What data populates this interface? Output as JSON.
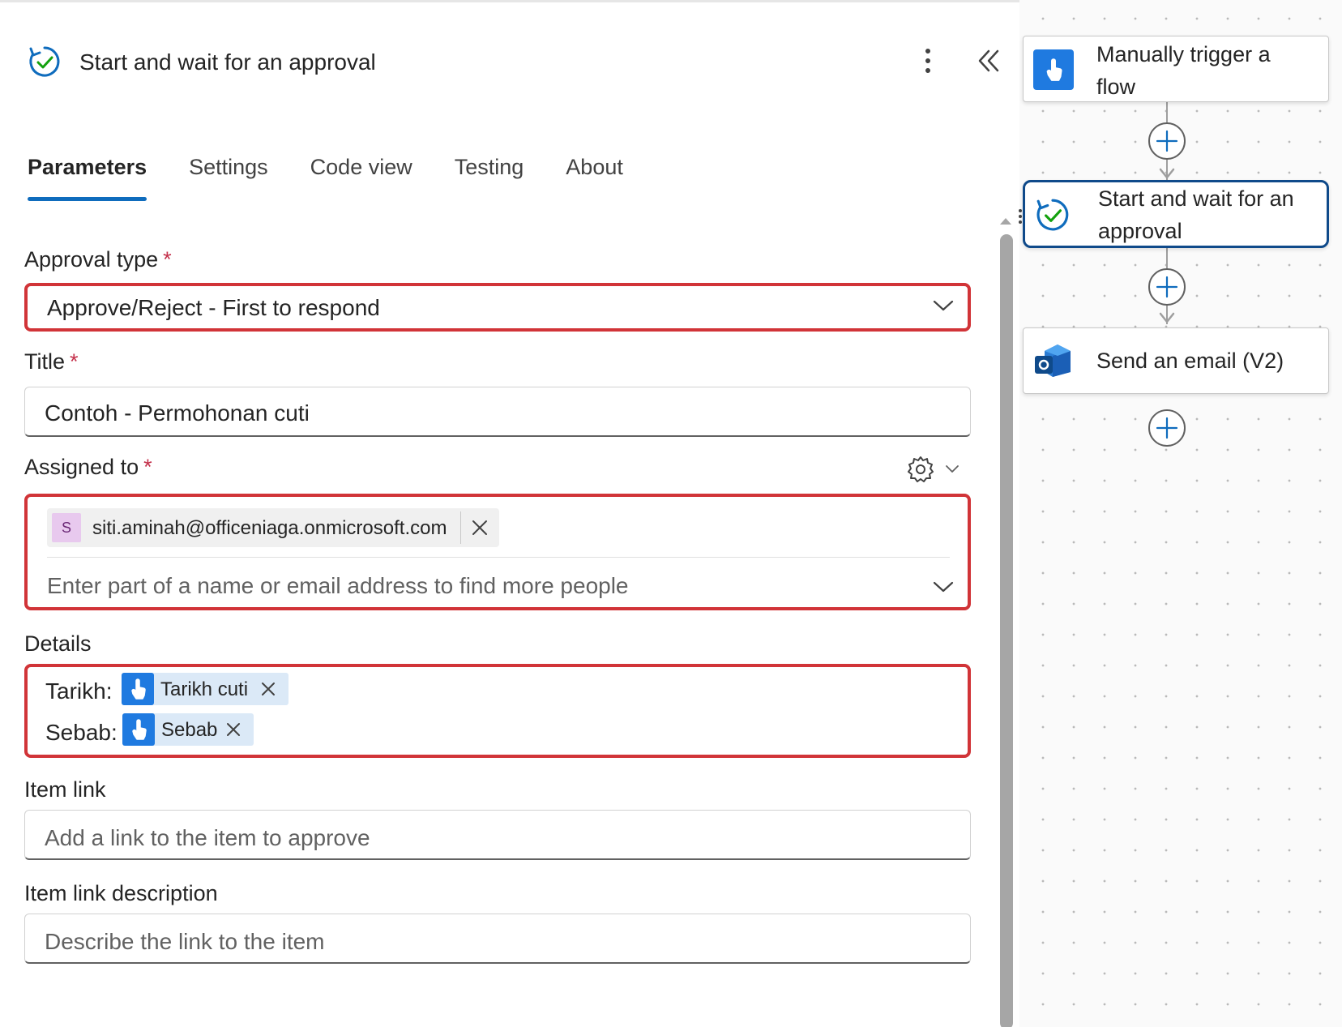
{
  "panel": {
    "title": "Start and wait for an approval",
    "tabs": [
      {
        "label": "Parameters",
        "active": true
      },
      {
        "label": "Settings",
        "active": false
      },
      {
        "label": "Code view",
        "active": false
      },
      {
        "label": "Testing",
        "active": false
      },
      {
        "label": "About",
        "active": false
      }
    ]
  },
  "form": {
    "approval_type": {
      "label": "Approval type",
      "required_mark": "*",
      "value": "Approve/Reject - First to respond"
    },
    "title": {
      "label": "Title",
      "required_mark": "*",
      "value": "Contoh - Permohonan cuti"
    },
    "assigned_to": {
      "label": "Assigned to",
      "required_mark": "*",
      "person": {
        "initial": "S",
        "email": "siti.aminah@officeniaga.onmicrosoft.com"
      },
      "placeholder": "Enter part of a name or email address to find more people"
    },
    "details": {
      "label": "Details",
      "lines": [
        {
          "prefix": "Tarikh:",
          "token": "Tarikh cuti"
        },
        {
          "prefix": "Sebab:",
          "token": "Sebab"
        }
      ]
    },
    "item_link": {
      "label": "Item link",
      "placeholder": "Add a link to the item to approve"
    },
    "item_link_description": {
      "label": "Item link description",
      "placeholder": "Describe the link to the item"
    }
  },
  "canvas": {
    "nodes": [
      {
        "label_line1": "Manually trigger a",
        "label_line2": "flow",
        "icon": "manual-trigger-icon"
      },
      {
        "label_line1": "Start and wait for an",
        "label_line2": "approval",
        "icon": "approval-icon",
        "selected": true
      },
      {
        "label_line1": "Send an email (V2)",
        "label_line2": "",
        "icon": "outlook-icon"
      }
    ]
  },
  "colors": {
    "accent": "#0f6cbd",
    "highlight_frame": "#d13438",
    "required": "#c4314b",
    "token_blue": "#1f7ae0",
    "selected_node_border": "#0f4a8a"
  }
}
